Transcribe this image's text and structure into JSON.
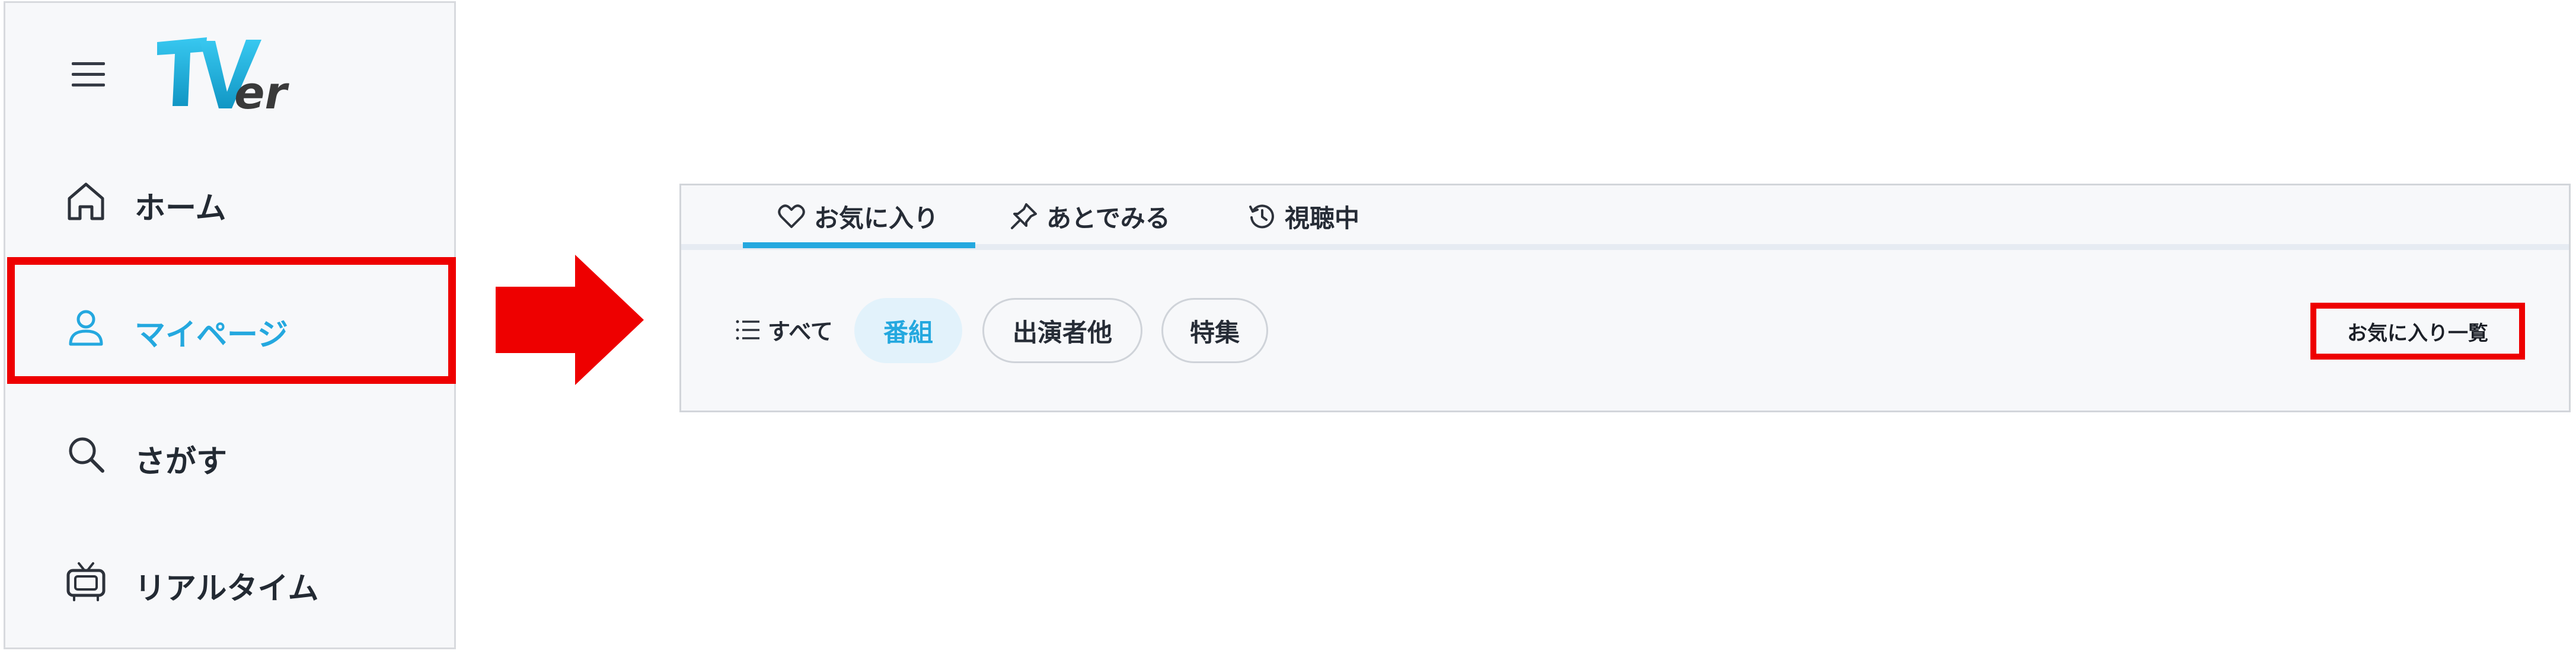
{
  "app": {
    "logo_text": "TVer"
  },
  "sidebar": {
    "items": [
      {
        "label": "ホーム",
        "icon": "home-icon",
        "active": false
      },
      {
        "label": "マイページ",
        "icon": "person-icon",
        "active": true
      },
      {
        "label": "さがす",
        "icon": "search-icon",
        "active": false
      },
      {
        "label": "リアルタイム",
        "icon": "tv-icon",
        "active": false
      }
    ]
  },
  "mypage": {
    "tabs": [
      {
        "label": "お気に入り",
        "icon": "heart-icon",
        "active": true
      },
      {
        "label": "あとでみる",
        "icon": "pin-icon",
        "active": false
      },
      {
        "label": "視聴中",
        "icon": "history-icon",
        "active": false
      }
    ],
    "filters": {
      "all_label": "すべて",
      "chips": [
        {
          "label": "番組",
          "selected": true
        },
        {
          "label": "出演者他",
          "selected": false
        },
        {
          "label": "特集",
          "selected": false
        }
      ]
    },
    "list_link_label": "お気に入り一覧"
  },
  "colors": {
    "accent": "#24a8df",
    "highlight": "#ee0000",
    "text": "#222832",
    "panel_bg": "#f7f8fa"
  }
}
